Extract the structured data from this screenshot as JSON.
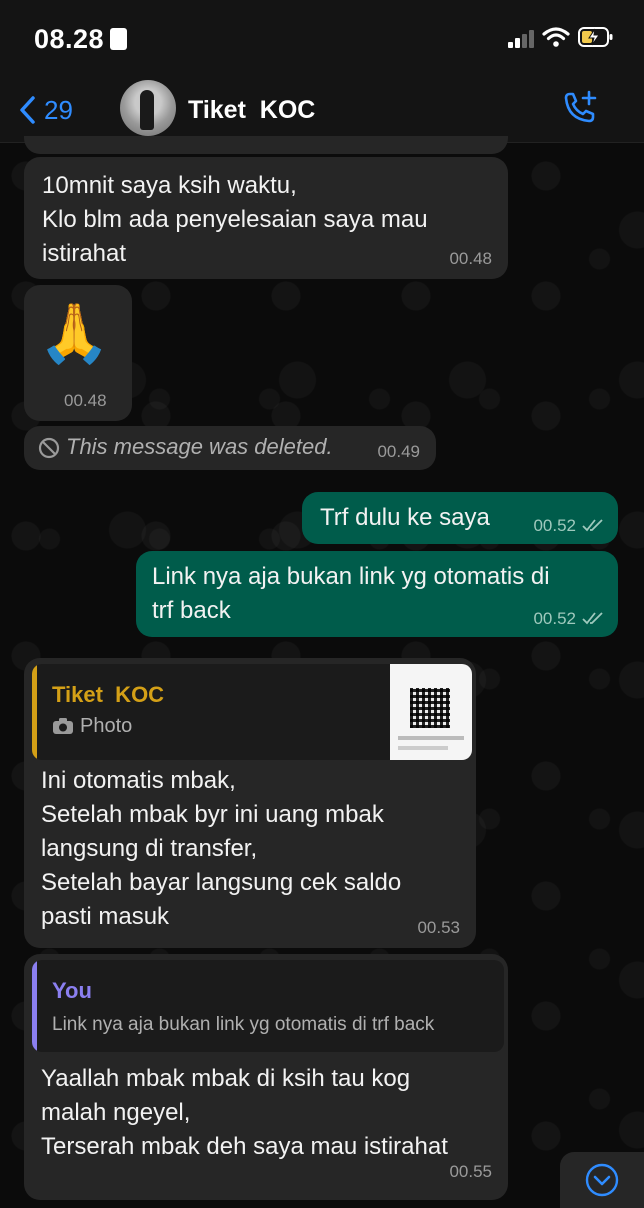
{
  "status_bar": {
    "time": "08.28"
  },
  "header": {
    "back_count": "29",
    "contact_name": "Tiket  KOC"
  },
  "messages": [
    {
      "text": "10mnit saya ksih waktu,\nKlo blm ada penyelesaian saya mau\nistirahat",
      "time": "00.48"
    },
    {
      "emoji": "🙏",
      "time": "00.48"
    },
    {
      "text": "This message was deleted.",
      "time": "00.49"
    },
    {
      "text": "Trf dulu ke saya",
      "time": "00.52"
    },
    {
      "text": "Link nya aja bukan link yg otomatis di\ntrf back",
      "time": "00.52"
    },
    {
      "reply_name": "Tiket  KOC",
      "reply_preview": "Photo",
      "text": "Ini otomatis mbak,\nSetelah mbak byr ini uang mbak\nlangsung di transfer,\nSetelah bayar langsung cek saldo\npasti masuk",
      "time": "00.53"
    },
    {
      "reply_name": "You",
      "reply_preview": "Link nya aja bukan link yg otomatis di trf back",
      "text": "Yaallah mbak mbak di ksih tau kog\nmalah ngeyel,\nTerserah mbak deh saya mau istirahat",
      "time": "00.55"
    }
  ],
  "colors": {
    "accent": "#2f8cff",
    "outgoing": "#005c4b",
    "incoming": "#262626",
    "reply_koc": "#d4a017",
    "reply_you": "#8b7ff0"
  }
}
